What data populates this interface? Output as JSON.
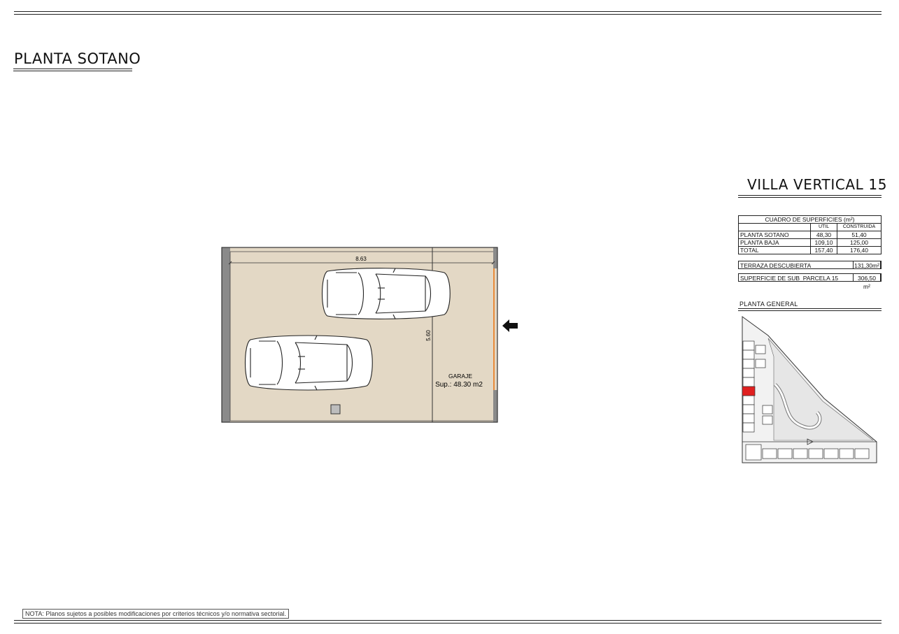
{
  "sheet": {
    "title": "PLANTA SOTANO",
    "villa_title": "VILLA VERTICAL 15",
    "note": "NOTA: Planos sujetos a posibles modificaciones por criterios técnicos y/o normativa sectorial."
  },
  "plan": {
    "dimension_width": "8.63",
    "dimension_depth": "5.60",
    "room_name": "GARAJE",
    "room_area": "Sup.: 48.30  m2",
    "colors": {
      "floor": "#e3d8c5",
      "wall": "#8a8a8a",
      "door": "#e98b3a"
    }
  },
  "areas_table": {
    "title": "CUADRO DE SUPERFICIES (m²)",
    "col_util": "UTIL",
    "col_construida": "CONSTRUIDA",
    "rows": [
      {
        "label": "PLANTA SOTANO",
        "util": "48,30",
        "construida": "51,40"
      },
      {
        "label": "PLANTA BAJA",
        "util": "109,10",
        "construida": "125,00"
      },
      {
        "label": "TOTAL",
        "util": "157,40",
        "construida": "176,40"
      }
    ]
  },
  "terrace": {
    "label": "TERRAZA DESCUBIERTA",
    "value": "131,30m²"
  },
  "parcel": {
    "label": "SUPERFICIE DE SUB_PARCELA  15",
    "value": "306,50 m²"
  },
  "general_plan": {
    "label": "PLANTA  GENERAL",
    "highlight_color": "#e02020"
  }
}
